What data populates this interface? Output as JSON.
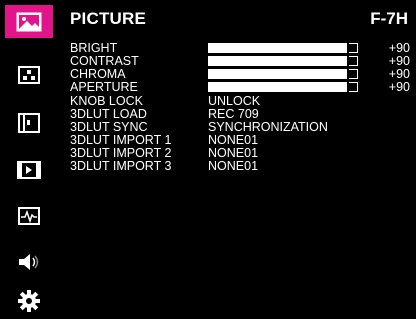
{
  "menu": {
    "title": "PICTURE",
    "model_code": "F-7H"
  },
  "sidebar": {
    "items": [
      {
        "icon": "picture-icon",
        "active": true
      },
      {
        "icon": "dots-grid-icon",
        "active": false
      },
      {
        "icon": "window-layout-icon",
        "active": false
      },
      {
        "icon": "media-screen-icon",
        "active": false
      },
      {
        "icon": "waveform-icon",
        "active": false
      },
      {
        "icon": "speaker-icon",
        "active": false
      },
      {
        "icon": "gear-icon",
        "active": false
      }
    ],
    "active_color": "#e1148a"
  },
  "settings": {
    "sliders": [
      {
        "label": "BRIGHT",
        "value": "+90",
        "level": 0.94
      },
      {
        "label": "CONTRAST",
        "value": "+90",
        "level": 0.94
      },
      {
        "label": "CHROMA",
        "value": "+90",
        "level": 0.94
      },
      {
        "label": "APERTURE",
        "value": "+90",
        "level": 0.94
      }
    ],
    "options": [
      {
        "label": "KNOB LOCK",
        "value": "UNLOCK"
      },
      {
        "label": "3DLUT LOAD",
        "value": "REC 709"
      },
      {
        "label": "3DLUT SYNC",
        "value": "SYNCHRONIZATION"
      },
      {
        "label": "3DLUT IMPORT 1",
        "value": "NONE01"
      },
      {
        "label": "3DLUT IMPORT 2",
        "value": "NONE01"
      },
      {
        "label": "3DLUT IMPORT 3",
        "value": "NONE01"
      }
    ]
  }
}
